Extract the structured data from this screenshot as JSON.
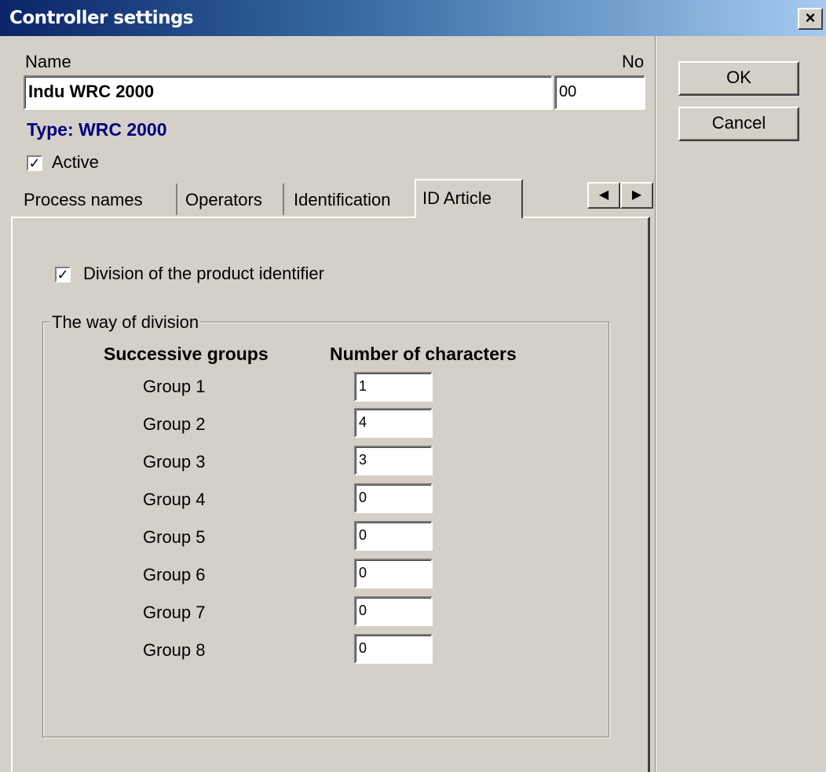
{
  "window": {
    "title": "Controller settings",
    "close_glyph": "×"
  },
  "form": {
    "name_label": "Name",
    "name_value": "Indu WRC 2000",
    "no_label": "No",
    "no_value": "00",
    "type_text": "Type: WRC 2000",
    "active_label": "Active",
    "active_checked": true
  },
  "buttons": {
    "ok": "OK",
    "cancel": "Cancel"
  },
  "tabs": {
    "items": [
      {
        "label": "Process names"
      },
      {
        "label": "Operators"
      },
      {
        "label": "Identification"
      },
      {
        "label": "ID Article"
      }
    ],
    "active_index": 3,
    "scroll_left": "◀",
    "scroll_right": "▶"
  },
  "id_article": {
    "division_label": "Division of the product identifier",
    "division_checked": true,
    "group_title": "The way of division",
    "col_groups": "Successive groups",
    "col_chars": "Number of characters",
    "groups": [
      {
        "label": "Group 1",
        "value": "1"
      },
      {
        "label": "Group 2",
        "value": "4"
      },
      {
        "label": "Group 3",
        "value": "3"
      },
      {
        "label": "Group 4",
        "value": "0"
      },
      {
        "label": "Group 5",
        "value": "0"
      },
      {
        "label": "Group 6",
        "value": "0"
      },
      {
        "label": "Group 7",
        "value": "0"
      },
      {
        "label": "Group 8",
        "value": "0"
      }
    ]
  },
  "colors": {
    "title_start": "#0a246a",
    "title_end": "#a6caf0",
    "type_text": "#000080",
    "face": "#d4d0c8"
  },
  "icons": {
    "checkbox": "check-mark",
    "close": "close-icon"
  }
}
